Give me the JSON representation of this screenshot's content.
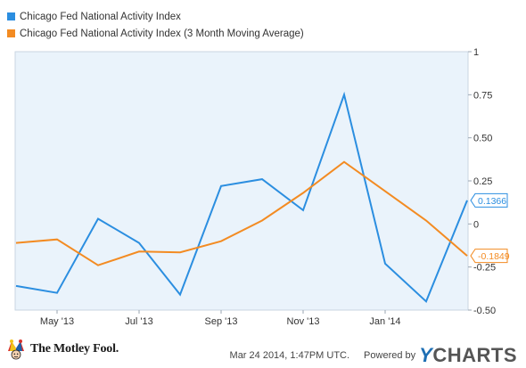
{
  "chart_data": {
    "type": "line",
    "x": [
      "2013-04",
      "2013-05",
      "2013-06",
      "2013-07",
      "2013-08",
      "2013-09",
      "2013-10",
      "2013-11",
      "2013-12",
      "2014-01",
      "2014-02",
      "2014-03"
    ],
    "xticks": [
      {
        "x": "2013-05",
        "label": "May '13"
      },
      {
        "x": "2013-07",
        "label": "Jul '13"
      },
      {
        "x": "2013-09",
        "label": "Sep '13"
      },
      {
        "x": "2013-11",
        "label": "Nov '13"
      },
      {
        "x": "2014-01",
        "label": "Jan '14"
      }
    ],
    "yticks": [
      {
        "y": 1,
        "label": "1"
      },
      {
        "y": 0.75,
        "label": "0.75"
      },
      {
        "y": 0.5,
        "label": "0.50"
      },
      {
        "y": 0.25,
        "label": "0.25"
      },
      {
        "y": 0,
        "label": "0"
      },
      {
        "y": -0.25,
        "label": "-0.25"
      },
      {
        "y": -0.5,
        "label": "-0.50"
      }
    ],
    "ylim": [
      -0.5,
      1
    ],
    "series": [
      {
        "name": "Chicago Fed National Activity Index",
        "color": "#2b8ee0",
        "values": [
          -0.36,
          -0.4,
          0.03,
          -0.11,
          -0.41,
          0.22,
          0.26,
          0.08,
          0.75,
          -0.23,
          -0.45,
          0.1366
        ],
        "last_label": "0.1366"
      },
      {
        "name": "Chicago Fed National Activity Index (3 Month Moving Average)",
        "color": "#f38b22",
        "values": [
          -0.11,
          -0.09,
          -0.24,
          -0.16,
          -0.165,
          -0.1,
          0.02,
          0.18,
          0.36,
          0.19,
          0.02,
          -0.1849
        ],
        "last_label": "-0.1849"
      }
    ],
    "plot_background": "#eaf3fb",
    "grid": false,
    "legend_position": "top-left"
  },
  "footer": {
    "brand_left": "The Motley Fool.",
    "timestamp": "Mar 24 2014, 1:47PM UTC.",
    "powered_by": "Powered by",
    "brand_right_y": "Y",
    "brand_right_rest": "CHARTS"
  }
}
